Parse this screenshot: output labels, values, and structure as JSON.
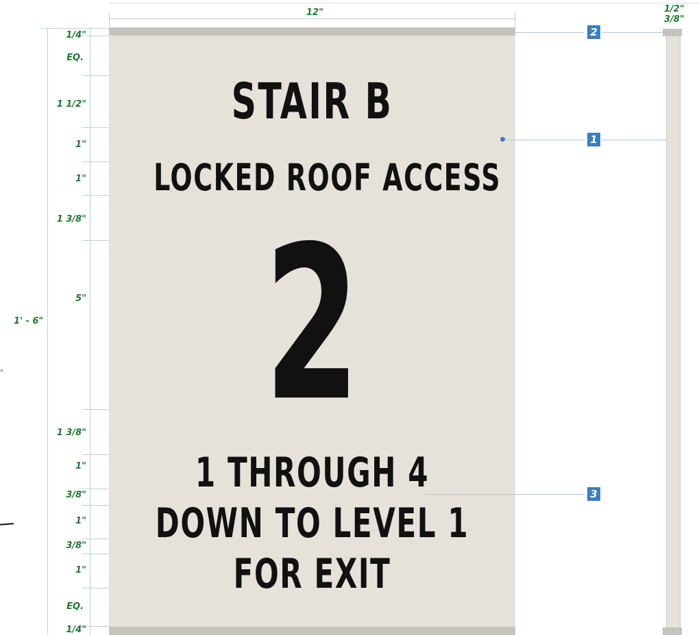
{
  "sign": {
    "line1": "STAIR B",
    "line2": "LOCKED ROOF ACCESS",
    "floor_number": "2",
    "line4": "1 THROUGH 4",
    "line5": "DOWN TO LEVEL 1",
    "line6": "FOR EXIT",
    "panel_color": "#e6e2d9",
    "text_color": "#111111"
  },
  "dimensions": {
    "width": "12\"",
    "total_height": "1' - 6\"",
    "top_margin": "1/4\"",
    "eq_top": "EQ.",
    "gap_1": "1 1/2\"",
    "gap_2": "1\"",
    "gap_3": "1\"",
    "gap_4": "1 3/8\"",
    "number_height": "5\"",
    "gap_5": "1 3/8\"",
    "gap_6": "1\"",
    "gap_7": "3/8\"",
    "gap_8": "1\"",
    "gap_9": "3/8\"",
    "gap_10": "1\"",
    "eq_bottom": "EQ.",
    "bottom_margin": "1/4\"",
    "side_top": "1/2\"",
    "side_bottom": "3/8\"",
    "stray_mark": "\""
  },
  "callouts": [
    {
      "number": "1"
    },
    {
      "number": "2"
    },
    {
      "number": "3"
    }
  ],
  "colors": {
    "dimension_text": "#1d7a2e",
    "callout_badge": "#3c7ec0",
    "rail": "#c6c3be"
  }
}
